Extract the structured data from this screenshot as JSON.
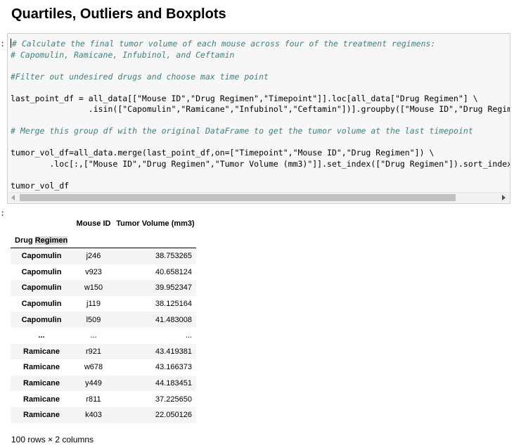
{
  "section_heading": "Quartiles, Outliers and Boxplots",
  "input_prompt": ":",
  "output_prompt": ":",
  "code_lines": [
    {
      "type": "comment",
      "text": "# Calculate the final tumor volume of each mouse across four of the treatment regimens:"
    },
    {
      "type": "comment",
      "text": "# Capomulin, Ramicane, Infubinol, and Ceftamin"
    },
    {
      "type": "blank",
      "text": ""
    },
    {
      "type": "comment",
      "text": "#Filter out undesired drugs and choose max time point"
    },
    {
      "type": "blank",
      "text": ""
    },
    {
      "type": "code",
      "text": "last_point_df = all_data[[\"Mouse ID\",\"Drug Regimen\",\"Timepoint\"]].loc[all_data[\"Drug Regimen\"] \\"
    },
    {
      "type": "code",
      "text": "                .isin([\"Capomulin\",\"Ramicane\",\"Infubinol\",\"Ceftamin\"])].groupby([\"Mouse ID\",\"Drug Regim"
    },
    {
      "type": "blank",
      "text": ""
    },
    {
      "type": "comment",
      "text": "# Merge this group df with the original DataFrame to get the tumor volume at the last timepoint"
    },
    {
      "type": "blank",
      "text": ""
    },
    {
      "type": "code",
      "text": "tumor_vol_df=all_data.merge(last_point_df,on=[\"Timepoint\",\"Mouse ID\",\"Drug Regimen\"]) \\"
    },
    {
      "type": "code",
      "text": "        .loc[:,[\"Mouse ID\",\"Drug Regimen\",\"Tumor Volume (mm3)\"]].set_index([\"Drug Regimen\"]).sort_index"
    },
    {
      "type": "blank",
      "text": ""
    },
    {
      "type": "code",
      "text": "tumor_vol_df"
    }
  ],
  "table": {
    "columns": [
      "Mouse ID",
      "Tumor Volume (mm3)"
    ],
    "index_name_part1": "Drug ",
    "index_name_part2": "Regimen",
    "rows": [
      {
        "regimen": "Capomulin",
        "mouse_id": "j246",
        "volume": "38.753265"
      },
      {
        "regimen": "Capomulin",
        "mouse_id": "v923",
        "volume": "40.658124"
      },
      {
        "regimen": "Capomulin",
        "mouse_id": "w150",
        "volume": "39.952347"
      },
      {
        "regimen": "Capomulin",
        "mouse_id": "j119",
        "volume": "38.125164"
      },
      {
        "regimen": "Capomulin",
        "mouse_id": "l509",
        "volume": "41.483008"
      },
      {
        "regimen": "...",
        "mouse_id": "...",
        "volume": "..."
      },
      {
        "regimen": "Ramicane",
        "mouse_id": "r921",
        "volume": "43.419381"
      },
      {
        "regimen": "Ramicane",
        "mouse_id": "w678",
        "volume": "43.166373"
      },
      {
        "regimen": "Ramicane",
        "mouse_id": "y449",
        "volume": "44.183451"
      },
      {
        "regimen": "Ramicane",
        "mouse_id": "r811",
        "volume": "37.225650"
      },
      {
        "regimen": "Ramicane",
        "mouse_id": "k403",
        "volume": "22.050126"
      }
    ]
  },
  "row_count_text": "100 rows × 2 columns"
}
